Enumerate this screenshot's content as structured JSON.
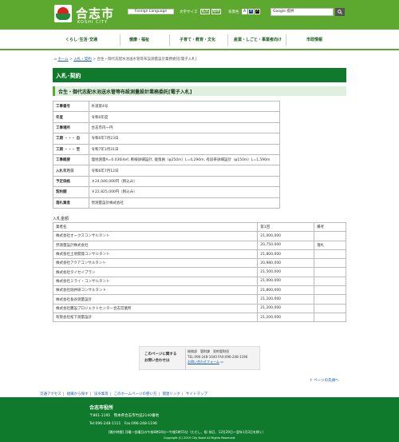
{
  "header": {
    "logo_text": "合志市",
    "logo_sub": "KOSHI CITY",
    "foreign_language": "Foreign Language",
    "text_size_label": "文字サイズ",
    "size_large": "拡大",
    "size_standard": "標準",
    "bg_color_label": "背景色",
    "search_placeholder": "Google 提供",
    "colors": {
      "brand_green": "#5da82f",
      "dark_green": "#107a2c"
    }
  },
  "nav": {
    "items": [
      {
        "label": "くらし･生活･交通"
      },
      {
        "label": "健康・福祉"
      },
      {
        "label": "子育て・教育・文化"
      },
      {
        "label": "産業・しごと・事業者向け"
      },
      {
        "label": "市政情報"
      }
    ]
  },
  "breadcrumb": {
    "home": "ホーム",
    "parent": "入札・契約",
    "current": "合生・御代志配水池送水管等布設測量設計業務委託[電子入札]"
  },
  "section_title": "入札･契約",
  "page_title": "合生・御代志配水池送水管等布設測量設計業務委託[電子入札]",
  "details": [
    {
      "key": "工事番号",
      "value": "水道第4号"
    },
    {
      "key": "年度",
      "value": "令和6年度"
    },
    {
      "key": "工事場所",
      "value": "合志市内一円"
    },
    {
      "key": "工期 ・・・ 自",
      "value": "令和6年7月23日"
    },
    {
      "key": "工期 ・・・ 至",
      "value": "令和7年1月31日"
    },
    {
      "key": "工事概要",
      "value": "理地測量A=0.036I4ef, 断線詳細設計, 能策員（φ250m）L=4,290m, 有段帯詳細設計（φ150m）L=1,590m"
    },
    {
      "key": "入札年月日",
      "value": "令和6年7月12日"
    },
    {
      "key": "予定価格",
      "value": "￥24,046,000円（税込み）"
    },
    {
      "key": "契約額",
      "value": "￥22,825,000円（税込み）"
    },
    {
      "key": "落札業者",
      "value": "琵測量設計株式会社"
    }
  ],
  "bid_label": "入札金額",
  "bid_table": {
    "headers": [
      "業者名",
      "第1回",
      "備考"
    ],
    "rows": [
      [
        "株式会社オークスコンサルタント",
        "21,000,000",
        ""
      ],
      [
        "琵測量設計株式会社",
        "20,750,000",
        "落札"
      ],
      [
        "株式会社土地開発コンサルタント",
        "21,800,000",
        ""
      ],
      [
        "株式会社アクアコンサルタント",
        "20,980,000",
        ""
      ],
      [
        "株式会社タイセイプラン",
        "21,500,000",
        ""
      ],
      [
        "株式会社ミライ・コンサルタント",
        "21,000,000",
        ""
      ],
      [
        "株式会社堀井研コンサルタント",
        "21,800,000",
        ""
      ],
      [
        "株式会社長谷測量設計",
        "21,200,000",
        ""
      ],
      [
        "株式会社騰設プロジェクトセンター合志営業所",
        "21,200,000",
        ""
      ],
      [
        "有限会社松下測量設計",
        "21,200,000",
        ""
      ]
    ]
  },
  "contact": {
    "label_line1": "このページに関する",
    "label_line2": "お問い合わせは",
    "dept": "総務部　管財課　契約管財班",
    "phone": "TEL:096-248-1040 FAX:096-248-1196",
    "form_link": "お問い合わせフォーム"
  },
  "page_top": "ページの先頭へ",
  "footer_links": [
    "交通アクセス",
    "組織から探す",
    "法令集等",
    "このホームページの使い方",
    "関連リンク",
    "サイトマップ"
  ],
  "footer": {
    "name": "合志市役所",
    "address": "〒861-1195　熊本県合志市竹迫2140番地",
    "tel": "Tel:096-248-1111　Fax:096-248-1196",
    "hours": "[開庁時間] 月曜～金曜日の午前8時30分～午後5時15分（ただし、祝･休日、12月29日～翌年1月3日を除く）",
    "copyright": "Copyright (C) 2019 City Koshi All Rights Reserved."
  }
}
